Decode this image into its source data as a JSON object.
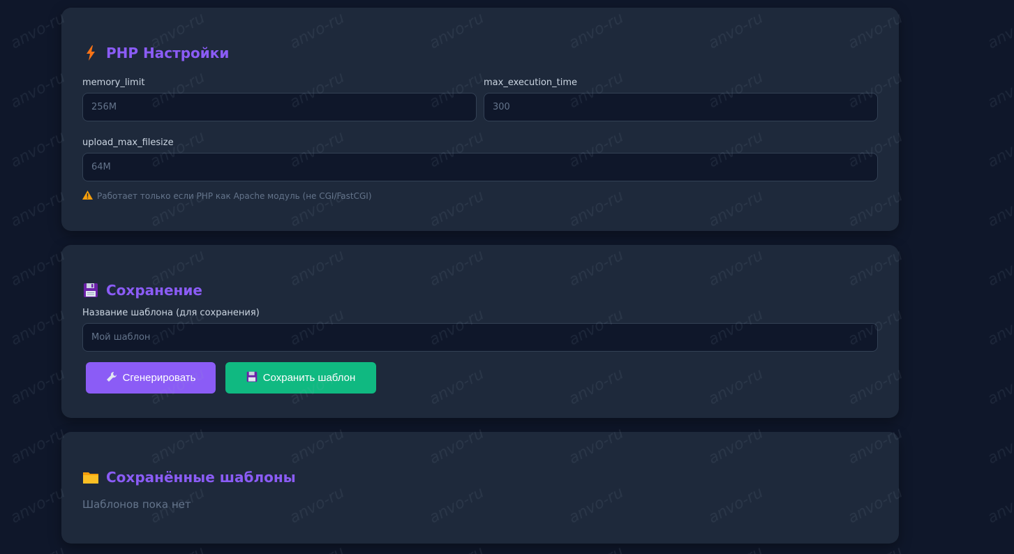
{
  "php_settings": {
    "title": "PHP Настройки",
    "icon": "lightning-icon",
    "memory_limit_label": "memory_limit",
    "memory_limit_placeholder": "256M",
    "max_execution_time_label": "max_execution_time",
    "max_execution_time_placeholder": "300",
    "upload_max_filesize_label": "upload_max_filesize",
    "upload_max_filesize_placeholder": "64M",
    "warning_text": "Работает только если PHP как Apache модуль (не CGI/FastCGI)"
  },
  "save_section": {
    "title": "Сохранение",
    "icon": "floppy-disk-icon",
    "template_name_label": "Название шаблона (для сохранения)",
    "template_name_placeholder": "Мой шаблон",
    "generate_button": "Сгенерировать",
    "save_button": "Сохранить шаблон"
  },
  "saved_templates": {
    "title": "Сохранённые шаблоны",
    "icon": "folder-icon",
    "empty_text": "Шаблонов пока нет"
  },
  "watermark_text": "anvo-ru",
  "colors": {
    "background": "#0f172a",
    "card": "#1e293b",
    "accent_purple": "#8b5cf6",
    "accent_green": "#10b981",
    "input_bg": "#0f172a",
    "warning_icon": "#f59e0b"
  }
}
